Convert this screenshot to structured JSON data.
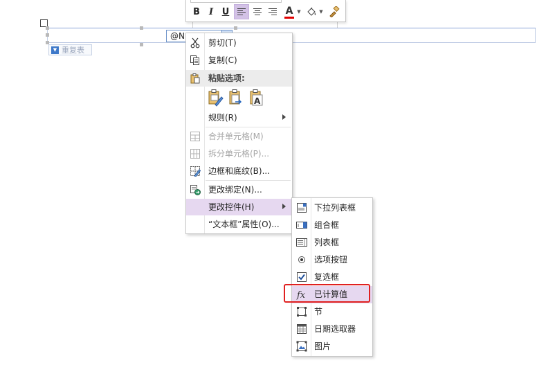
{
  "minibar": {
    "bold": "B",
    "italic": "I",
    "underline": "U",
    "font_color_glyph": "A",
    "colors": {
      "font_color": "#e00000",
      "selected_bg": "#d3c2e6"
    }
  },
  "document": {
    "field_text": "@NI",
    "repeat_tag": "重复表"
  },
  "context_menu": {
    "cut": {
      "label": "剪切(T)",
      "icon": "scissors-icon"
    },
    "copy": {
      "label": "复制(C)",
      "icon": "copy-icon"
    },
    "paste_options": {
      "label": "粘贴选项:",
      "icon": "clipboard-icon"
    },
    "rules": {
      "label": "规则(R)"
    },
    "merge_cells": {
      "label": "合并单元格(M)",
      "enabled": false
    },
    "split_cells": {
      "label": "拆分单元格(P)...",
      "enabled": false
    },
    "borders": {
      "label": "边框和底纹(B)..."
    },
    "change_binding": {
      "label": "更改绑定(N)..."
    },
    "change_control": {
      "label": "更改控件(H)",
      "highlighted": true
    },
    "properties": {
      "label": "“文本框”属性(O)..."
    }
  },
  "submenu": {
    "items": [
      {
        "label": "下拉列表框",
        "icon": "dropdown-list-icon"
      },
      {
        "label": "组合框",
        "icon": "combo-box-icon"
      },
      {
        "label": "列表框",
        "icon": "list-box-icon"
      },
      {
        "label": "选项按钮",
        "icon": "radio-button-icon"
      },
      {
        "label": "复选框",
        "icon": "checkbox-icon"
      },
      {
        "label": "已计算值",
        "icon": "fx-icon",
        "highlighted": true
      },
      {
        "label": "节",
        "icon": "section-icon"
      },
      {
        "label": "日期选取器",
        "icon": "date-picker-icon"
      },
      {
        "label": "图片",
        "icon": "picture-icon"
      }
    ],
    "highlight_color": "#e02020"
  }
}
